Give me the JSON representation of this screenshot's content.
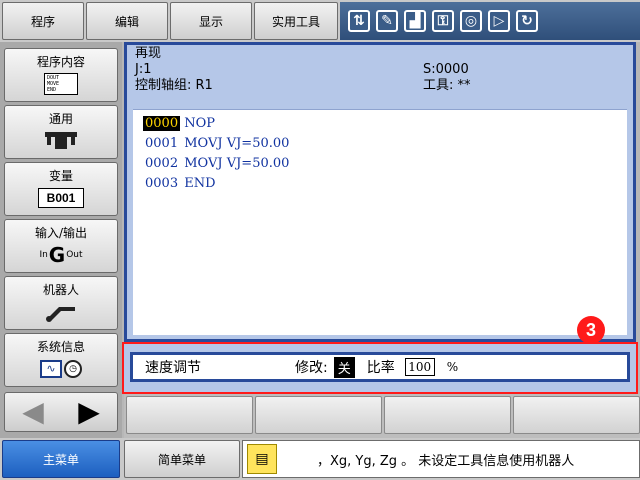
{
  "top_menu": {
    "program": "程序",
    "edit": "编辑",
    "display": "显示",
    "utility": "实用工具"
  },
  "status_icons": [
    "coordinate-icon",
    "edit-mode-icon",
    "speed-level-icon",
    "security-key-icon",
    "servo-status-icon",
    "play-mode-icon",
    "cycle-icon"
  ],
  "side_menu": {
    "program_content": "程序内容",
    "program_icon_text": "DOUT\nMOVE\nEND",
    "general": "通用",
    "variable": "变量",
    "variable_icon_text": "B001",
    "io": "输入/输出",
    "io_in": "In",
    "io_out": "Out",
    "robot": "机器人",
    "system_info": "系统信息"
  },
  "main": {
    "title": "再现",
    "job": "J:1",
    "step": "S:0000",
    "control_group": "控制轴组: R1",
    "tool": "工具: **",
    "lines": [
      {
        "num": "0000",
        "text": " NOP"
      },
      {
        "num": "0001",
        "text": " MOVJ VJ=50.00"
      },
      {
        "num": "0002",
        "text": " MOVJ VJ=50.00"
      },
      {
        "num": "0003",
        "text": " END"
      }
    ]
  },
  "marker": "3",
  "speed_panel": {
    "title": "速度调节",
    "modify_label": "修改:",
    "modify_value": "关",
    "ratio_label": "比率",
    "ratio_value": "100",
    "percent": "%"
  },
  "bottom": {
    "main_menu": "主菜单",
    "simple_menu": "简单菜单",
    "message": "，Xg, Yg, Zg 。    未设定工具信息使用机器人"
  }
}
